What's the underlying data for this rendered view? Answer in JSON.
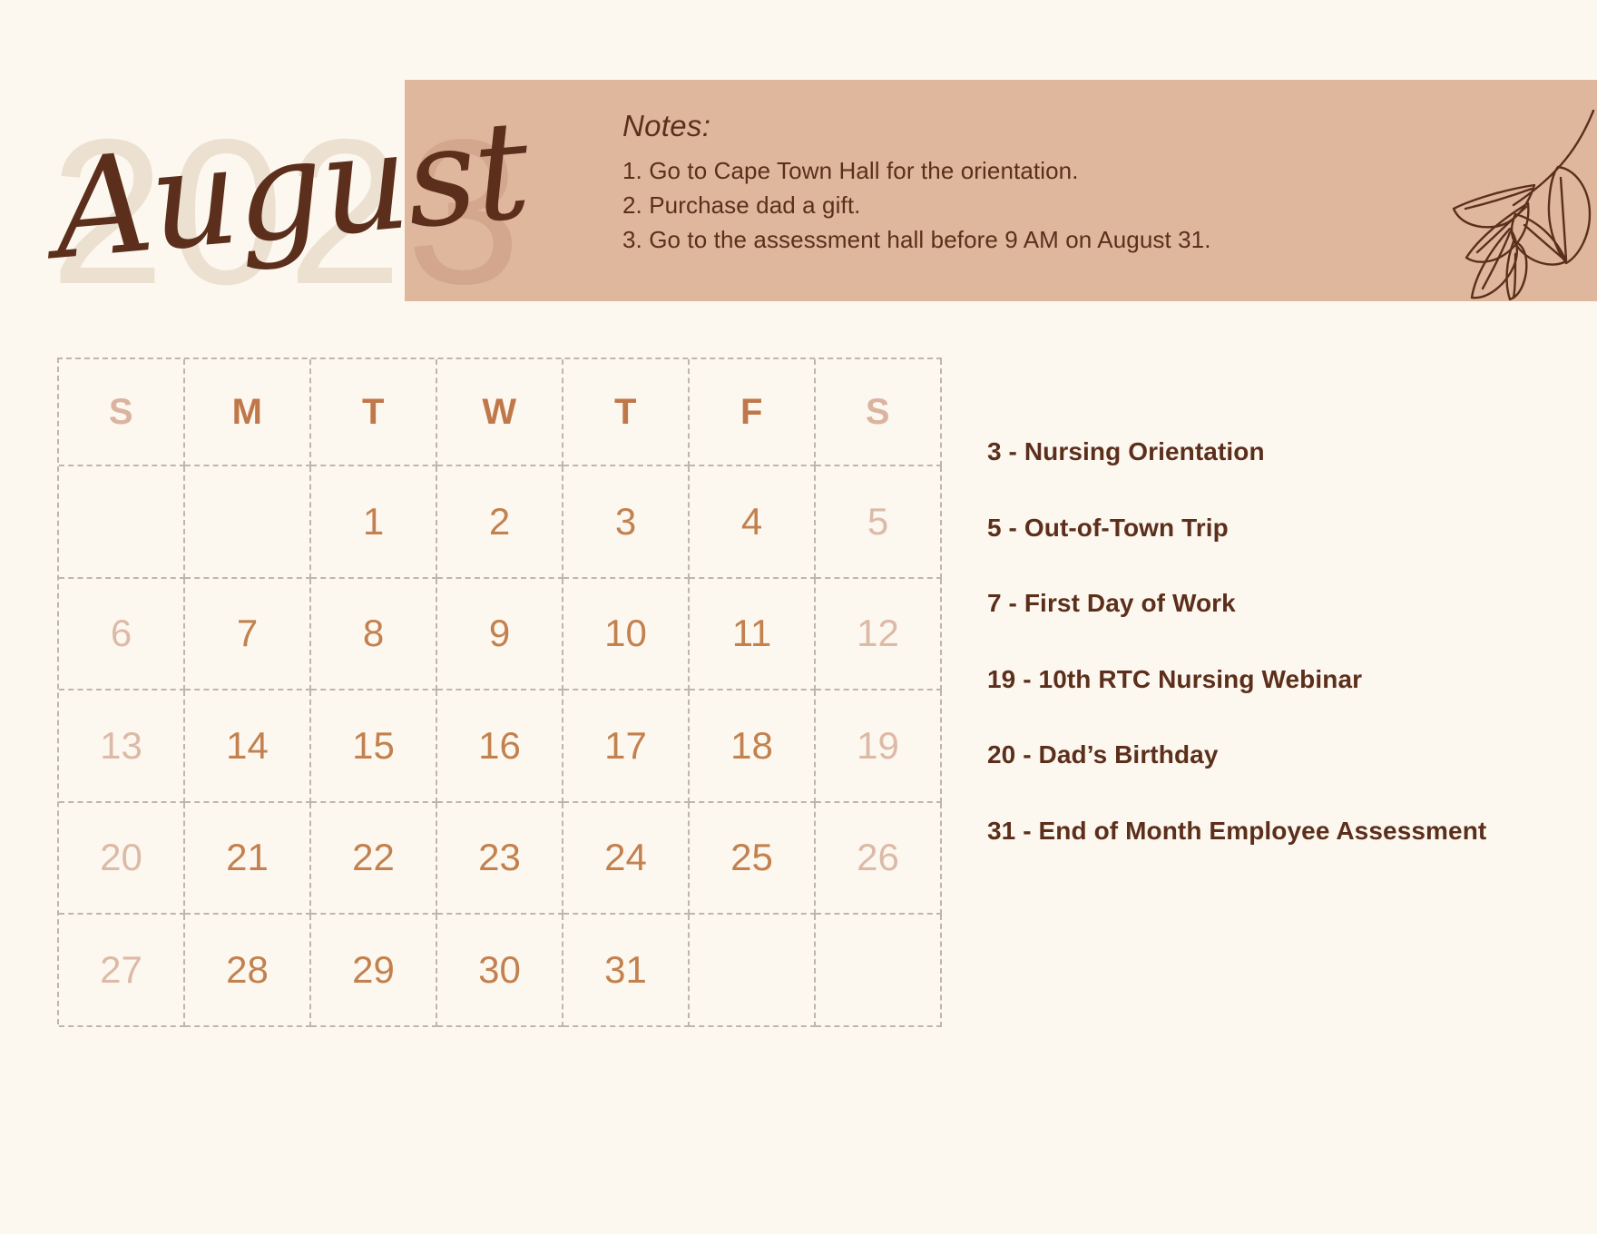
{
  "header": {
    "year": "2023",
    "month": "August",
    "notes_title": "Notes:",
    "notes": [
      "1. Go to Cape Town Hall for the orientation.",
      "2. Purchase dad a gift.",
      "3. Go to the assessment hall before 9 AM on August 31."
    ],
    "decoration": "leaf-branch-icon"
  },
  "calendar": {
    "weekday_headers": [
      "S",
      "M",
      "T",
      "W",
      "T",
      "F",
      "S"
    ],
    "weeks": [
      [
        "",
        "",
        "1",
        "2",
        "3",
        "4",
        "5"
      ],
      [
        "6",
        "7",
        "8",
        "9",
        "10",
        "11",
        "12"
      ],
      [
        "13",
        "14",
        "15",
        "16",
        "17",
        "18",
        "19"
      ],
      [
        "20",
        "21",
        "22",
        "23",
        "24",
        "25",
        "26"
      ],
      [
        "27",
        "28",
        "29",
        "30",
        "31",
        "",
        ""
      ]
    ]
  },
  "events": [
    "3 - Nursing Orientation",
    "5 -  Out-of-Town Trip",
    "7 - First Day of Work",
    "19 - 10th RTC Nursing Webinar",
    "20 - Dad’s Birthday",
    "31 - End of Month Employee Assessment"
  ],
  "colors": {
    "page_background": "#fdf8ef",
    "banner_background": "#dfb79d",
    "year_text": "#ece0d1",
    "month_text": "#5c2f1c",
    "notes_text": "#5c2f1c",
    "weekday_header": "#c0784a",
    "weekend_header": "#d9b4a1",
    "weekday_number": "#c2814f",
    "weekend_number": "#dcbaa8",
    "grid_line": "#bdb6ad",
    "event_text": "#5c2f1c"
  }
}
